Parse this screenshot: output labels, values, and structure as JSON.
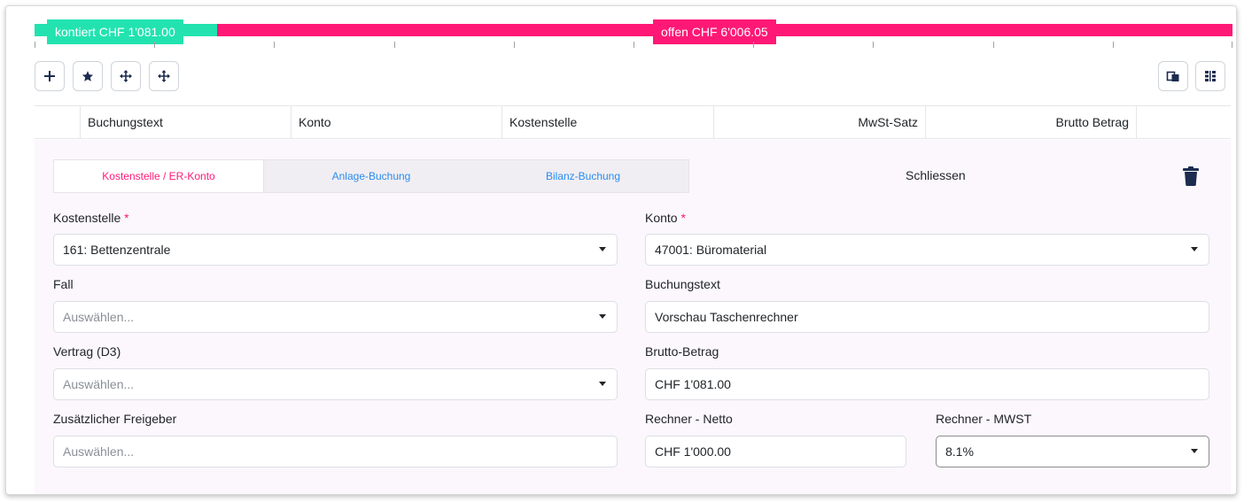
{
  "progress": {
    "contiert_label": "kontiert CHF 1'081.00",
    "offen_label": "offen CHF 6'006.05",
    "contiert_fraction": 0.1525,
    "colors": {
      "contiert": "#22e3b0",
      "offen": "#ff1876"
    }
  },
  "toolbar": {
    "icons": [
      "plus-icon",
      "star-icon",
      "move-icon",
      "move-icon",
      "copy-icon",
      "columns-icon"
    ]
  },
  "table": {
    "columns": [
      "Buchungstext",
      "Konto",
      "Kostenstelle",
      "MwSt-Satz",
      "Brutto Betrag"
    ]
  },
  "editor": {
    "tabs": [
      "Kostenstelle / ER-Konto",
      "Anlage-Buchung",
      "Bilanz-Buchung"
    ],
    "close_label": "Schliessen",
    "required_mark": "*",
    "fields": {
      "kostenstelle": {
        "label": "Kostenstelle",
        "value": "161: Bettenzentrale"
      },
      "konto": {
        "label": "Konto",
        "value": "47001: Büromaterial"
      },
      "fall": {
        "label": "Fall",
        "placeholder": "Auswählen..."
      },
      "buchungstext": {
        "label": "Buchungstext",
        "value": "Vorschau Taschenrechner"
      },
      "vertrag": {
        "label": "Vertrag (D3)",
        "placeholder": "Auswählen..."
      },
      "brutto": {
        "label": "Brutto-Betrag",
        "value": "CHF 1'081.00"
      },
      "freigeber": {
        "label": "Zusätzlicher Freigeber",
        "placeholder": "Auswählen..."
      },
      "netto": {
        "label": "Rechner - Netto",
        "value": "CHF 1'000.00"
      },
      "mwst": {
        "label": "Rechner - MWST",
        "value": "8.1%"
      }
    }
  }
}
